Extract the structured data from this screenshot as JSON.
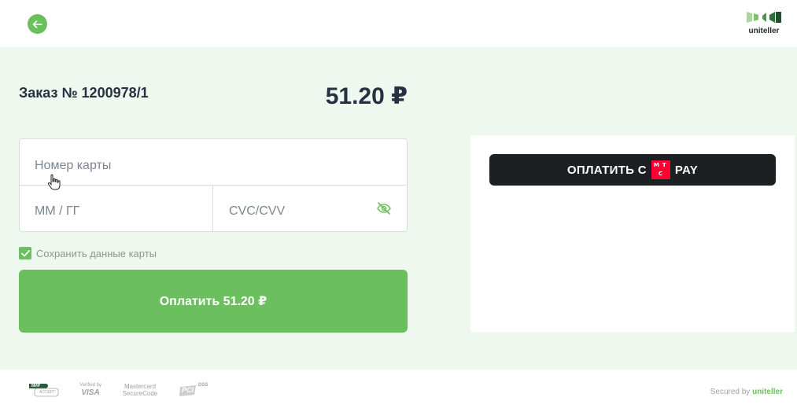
{
  "header": {
    "back_icon": "arrow-left-icon",
    "logo_text": "uniteller"
  },
  "order": {
    "title": "Заказ № 1200978/1",
    "amount": "51.20 ₽"
  },
  "card_form": {
    "number_placeholder": "Номер карты",
    "expiry_placeholder": "ММ / ГГ",
    "cvc_placeholder": "CVC/CVV",
    "cvc_visibility_icon": "eye-off-icon"
  },
  "save_card": {
    "label": "Сохранить данные карты",
    "checked": true
  },
  "pay_button": {
    "label": "Оплатить 51.20 ₽"
  },
  "mts_pay": {
    "prefix": "ОПЛАТИТЬ С",
    "logo_letters": [
      "М",
      "Т",
      "С"
    ],
    "suffix": "PAY"
  },
  "footer": {
    "badges": {
      "mir": "МИР",
      "mir_sub": "ACCEPT",
      "visa_line1": "Verified by",
      "visa_line2": "VISA",
      "mc_line1": "Mastercard",
      "mc_line2": "SecureCode",
      "pci_line1": "PCI",
      "pci_line2": "DSS"
    },
    "secured_prefix": "Secured by",
    "secured_brand": "uniteller"
  },
  "colors": {
    "accent": "#6cbf5e",
    "main_bg": "#eef8ee",
    "text": "#273142",
    "mts_red": "#ff0032",
    "mts_button": "#1d2023"
  }
}
